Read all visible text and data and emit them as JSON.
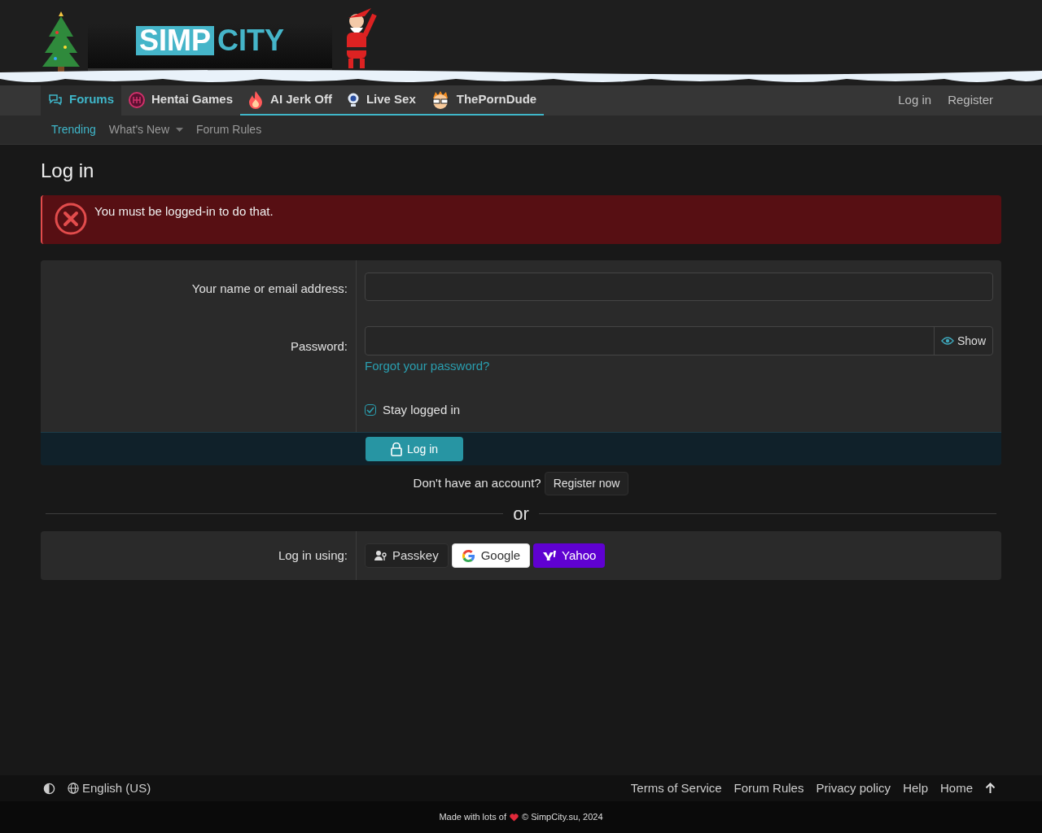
{
  "logo": {
    "word_1": "SIMP",
    "word_2": "CITY"
  },
  "nav_tabs": [
    {
      "label": "Forums",
      "selected": true,
      "highlighted": false,
      "kind": "chat"
    },
    {
      "label": "Hentai Games",
      "selected": false,
      "highlighted": false,
      "kind": "badge"
    },
    {
      "label": "AI Jerk Off",
      "selected": false,
      "highlighted": true,
      "kind": "flame"
    },
    {
      "label": "Live Sex",
      "selected": false,
      "highlighted": true,
      "kind": "cam"
    },
    {
      "label": "ThePornDude",
      "selected": false,
      "highlighted": true,
      "kind": "face"
    }
  ],
  "account_links": [
    "Log in",
    "Register"
  ],
  "sub_nav": [
    {
      "label": "Trending",
      "selected": true,
      "dropdown": false
    },
    {
      "label": "What's New",
      "selected": false,
      "dropdown": true
    },
    {
      "label": "Forum Rules",
      "selected": false,
      "dropdown": false
    }
  ],
  "page_title": "Log in",
  "error_message": "You must be logged-in to do that.",
  "login_form": {
    "name_label": "Your name or email address:",
    "password_label": "Password:",
    "show_button": "Show",
    "forgot_link": "Forgot your password?",
    "stay_logged_in": {
      "label": "Stay logged in",
      "checked": true
    },
    "submit_button": "Log in"
  },
  "register_prompt": {
    "text": "Don't have an account?",
    "button": "Register now"
  },
  "divider_text": "or",
  "external_login": {
    "label": "Log in using:",
    "providers": [
      {
        "label": "Passkey",
        "kind": "passkey"
      },
      {
        "label": "Google",
        "kind": "google"
      },
      {
        "label": "Yahoo",
        "kind": "yahoo"
      }
    ]
  },
  "footer": {
    "language": "English (US)",
    "links": [
      "Terms of Service",
      "Forum Rules",
      "Privacy policy",
      "Help",
      "Home"
    ],
    "credit_before": "Made with lots of",
    "credit_after": "© SimpCity.su, 2024"
  }
}
